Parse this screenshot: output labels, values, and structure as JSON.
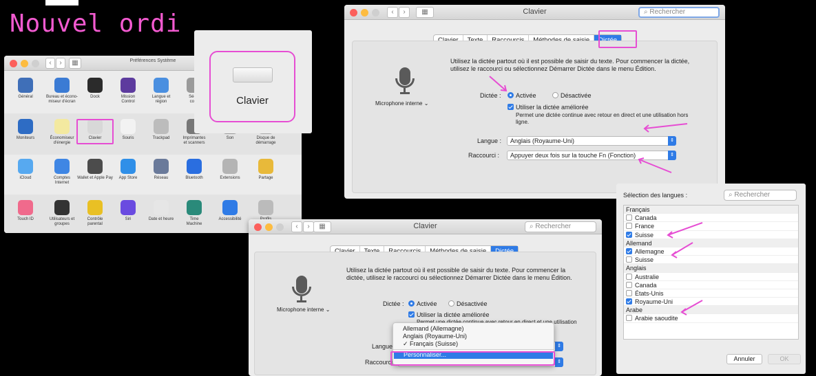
{
  "headline": "Nouvel ordi",
  "prefs": {
    "title": "Préférences Système",
    "rows": [
      [
        {
          "label": "Général",
          "color": "#3f6fb8"
        },
        {
          "label": "Bureau et écono-\nmiseur d'écran",
          "color": "#3b7bd4"
        },
        {
          "label": "Dock",
          "color": "#2b2b2b"
        },
        {
          "label": "Mission\nControl",
          "color": "#5d3b9e"
        },
        {
          "label": "Langue et\nrégion",
          "color": "#4a8fe0"
        },
        {
          "label": "Sécu-\nconfi",
          "color": "#9a9a9a"
        }
      ],
      [
        {
          "label": "Moniteurs",
          "color": "#2e6cc4"
        },
        {
          "label": "Économiseur\nd'énergie",
          "color": "#f3e9a0"
        },
        {
          "label": "Clavier",
          "color": "#d8d8d8"
        },
        {
          "label": "Souris",
          "color": "#f2f2f2"
        },
        {
          "label": "Trackpad",
          "color": "#bcbcbc"
        },
        {
          "label": "Imprimantes\net scanners",
          "color": "#777"
        },
        {
          "label": "Son",
          "color": "#999"
        },
        {
          "label": "Disque de\ndémarrage",
          "color": "#aaa"
        }
      ],
      [
        {
          "label": "iCloud",
          "color": "#57a9f0"
        },
        {
          "label": "Comptes\nInternet",
          "color": "#3f86e4"
        },
        {
          "label": "Wallet et Apple Pay",
          "color": "#4c4c4c"
        },
        {
          "label": "App Store",
          "color": "#2f8fe8"
        },
        {
          "label": "Réseau",
          "color": "#6a7a9a"
        },
        {
          "label": "Bluetooth",
          "color": "#2a6ee0"
        },
        {
          "label": "Extensions",
          "color": "#b4b4b4"
        },
        {
          "label": "Partage",
          "color": "#e8b93a"
        }
      ],
      [
        {
          "label": "Touch ID",
          "color": "#f06a8c"
        },
        {
          "label": "Utilisateurs et\ngroupes",
          "color": "#333"
        },
        {
          "label": "Contrôle\nparental",
          "color": "#e9c024"
        },
        {
          "label": "Siri",
          "color": "#6a4be0"
        },
        {
          "label": "Date et heure",
          "color": "#e6e6e6"
        },
        {
          "label": "Time\nMachine",
          "color": "#2a8a7a"
        },
        {
          "label": "Accessibilité",
          "color": "#2f7be6"
        },
        {
          "label": "Profils",
          "color": "#bbb"
        }
      ]
    ]
  },
  "zoom": {
    "label": "Clavier"
  },
  "dictation": {
    "title": "Clavier",
    "search_placeholder": "Rechercher",
    "tabs": [
      "Clavier",
      "Texte",
      "Raccourcis",
      "Méthodes de saisie",
      "Dictée"
    ],
    "intro": "Utilisez la dictée partout où il est possible de saisir du texte. Pour commencer la dictée, utilisez le raccourci ou sélectionnez Démarrer Dictée dans le menu Édition.",
    "mic_label": "Microphone interne ⌄",
    "dictee_label": "Dictée :",
    "on_label": "Activée",
    "off_label": "Désactivée",
    "enhanced_label": "Utiliser la dictée améliorée",
    "enhanced_desc": "Permet une dictée continue avec retour en direct et une utilisation hors ligne.",
    "langue_label": "Langue :",
    "langue_value": "Anglais (Royaume-Uni)",
    "raccourci_label": "Raccourci :",
    "raccourci_value": "Appuyer deux fois sur la touche Fn (Fonction)"
  },
  "dictation2": {
    "enhanced_desc_partial": "Permet une dictée continue avec retour en direct et une utilisation",
    "langue_label_short": "Langue",
    "raccourci_label_short": "Raccourci",
    "menu_items": [
      "Allemand (Allemagne)",
      "Anglais (Royaume-Uni)",
      "✓ Français (Suisse)"
    ],
    "menu_custom": "Personnaliser..."
  },
  "languages": {
    "title": "Sélection des langues :",
    "search_placeholder": "Rechercher",
    "groups": [
      {
        "name": "Français",
        "items": [
          {
            "label": "Canada",
            "checked": false
          },
          {
            "label": "France",
            "checked": false
          },
          {
            "label": "Suisse",
            "checked": true
          }
        ]
      },
      {
        "name": "Allemand",
        "items": [
          {
            "label": "Allemagne",
            "checked": true
          },
          {
            "label": "Suisse",
            "checked": false
          }
        ]
      },
      {
        "name": "Anglais",
        "items": [
          {
            "label": "Australie",
            "checked": false
          },
          {
            "label": "Canada",
            "checked": false
          },
          {
            "label": "États-Unis",
            "checked": false
          },
          {
            "label": "Royaume-Uni",
            "checked": true
          }
        ]
      },
      {
        "name": "Arabe",
        "items": [
          {
            "label": "Arabie saoudite",
            "checked": false
          }
        ]
      }
    ],
    "cancel": "Annuler",
    "ok": "OK"
  },
  "colors": {
    "accent": "#2f7be6",
    "highlight": "#e64dd3",
    "headline": "#f25ad0"
  }
}
